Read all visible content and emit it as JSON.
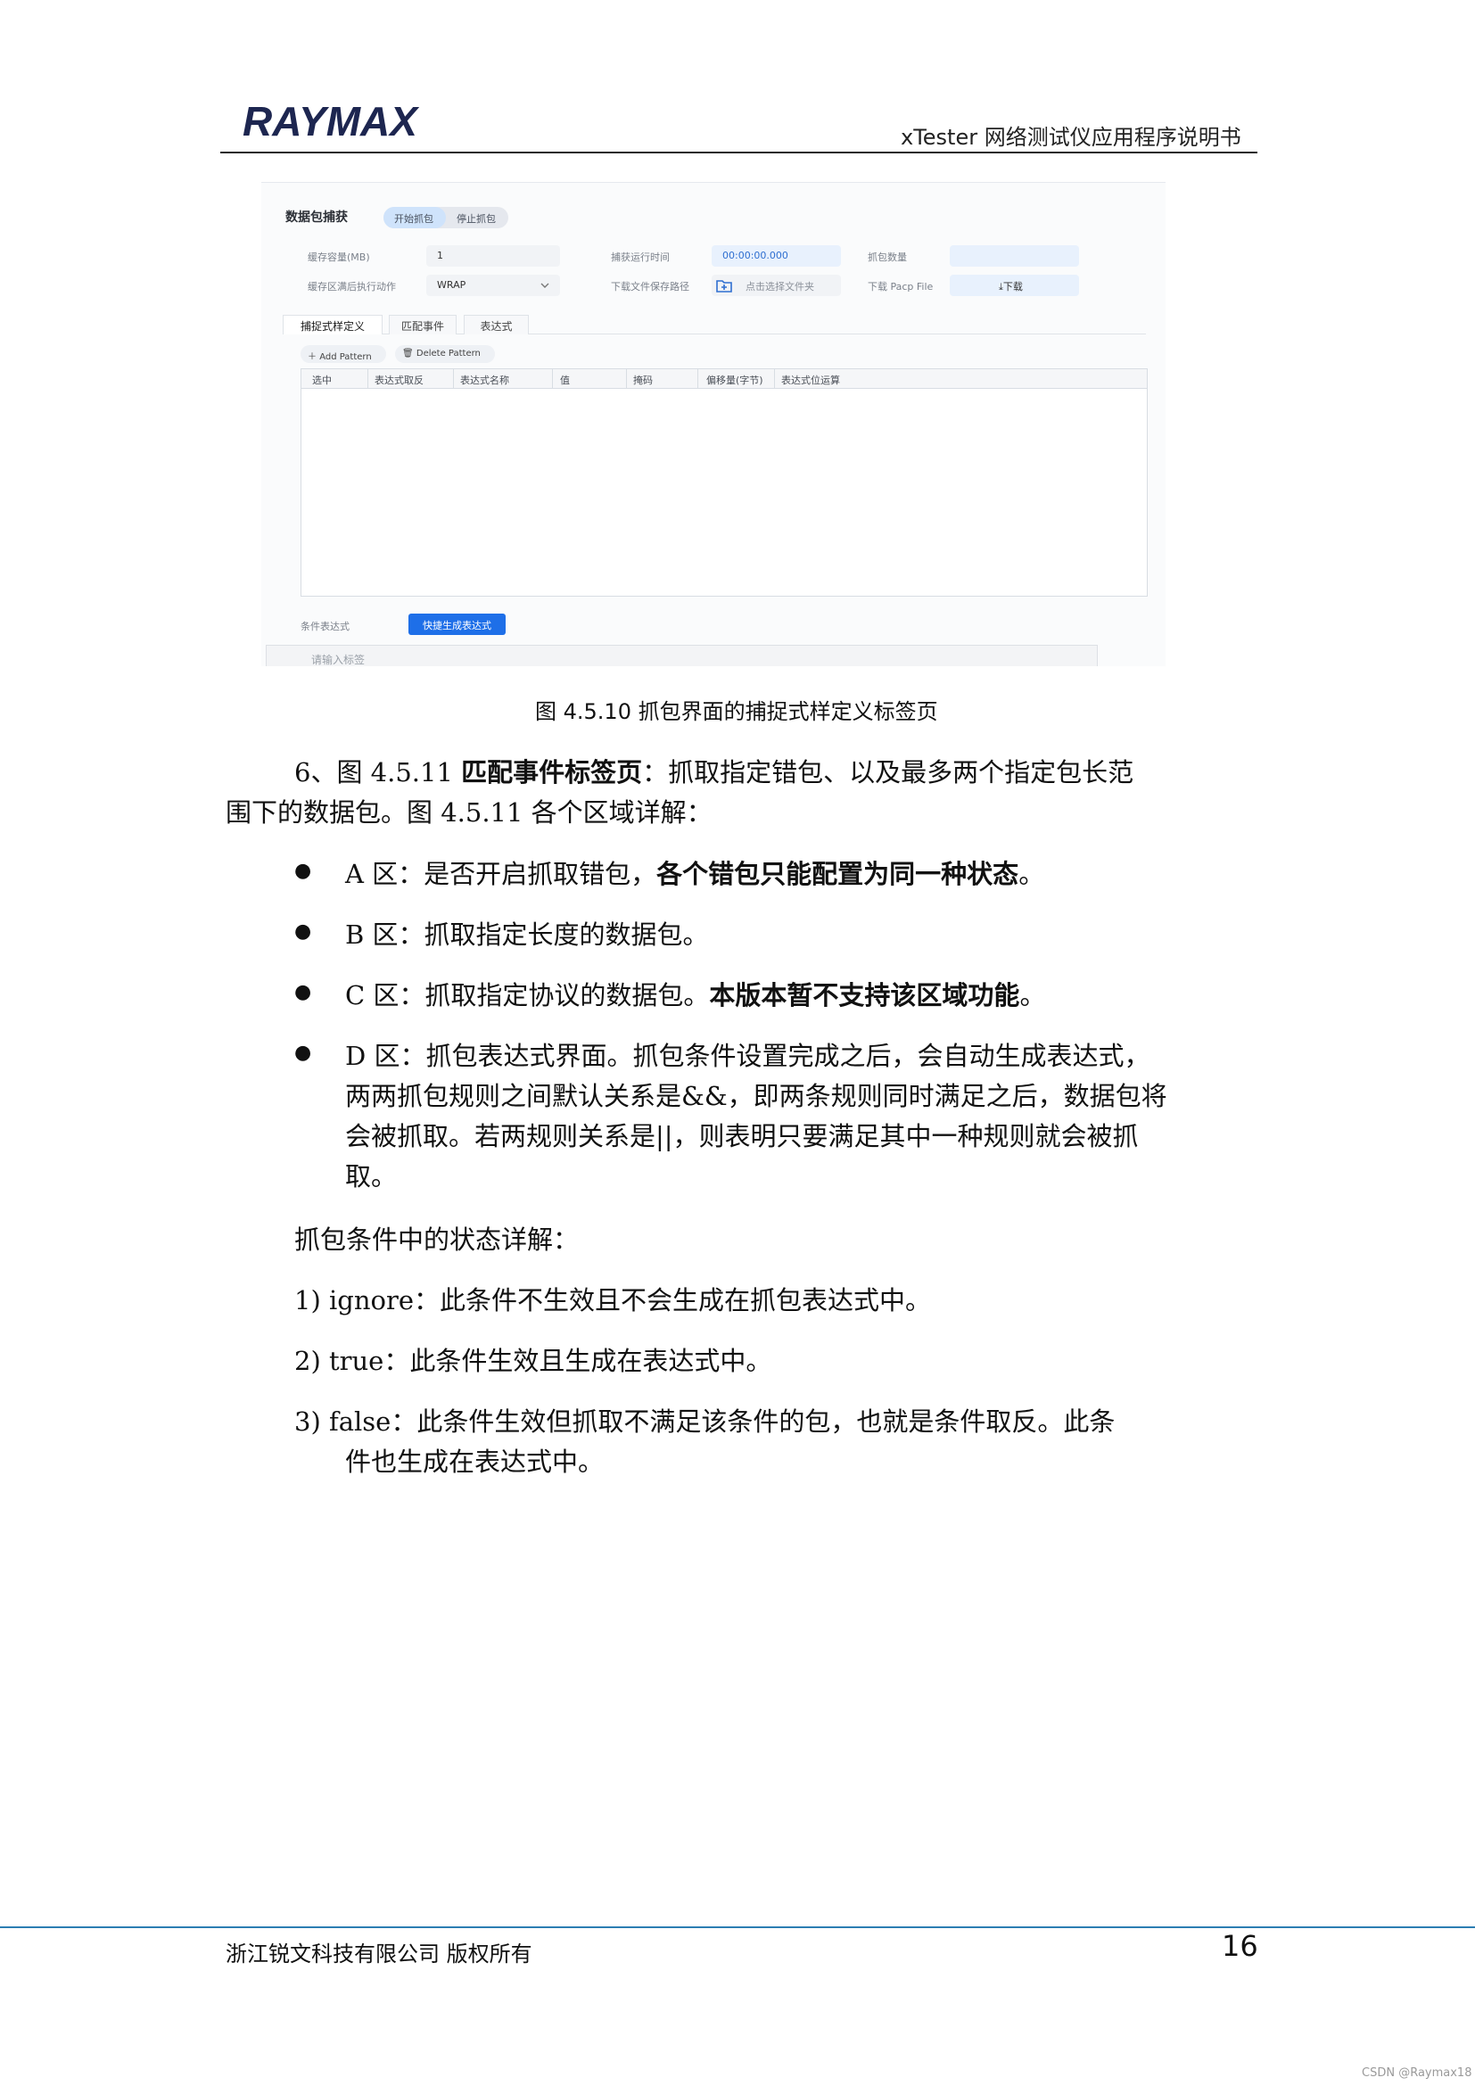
{
  "header": {
    "brand": "RAYMAX",
    "doc_title": "xTester 网络测试仪应用程序说明书"
  },
  "screenshot": {
    "title": "数据包捕获",
    "start_capture": "开始抓包",
    "stop_capture": "停止抓包",
    "buffer_label": "缓存容量(MB)",
    "buffer_value": "1",
    "full_action_label": "缓存区满后执行动作",
    "full_action_value": "WRAP",
    "run_time_label": "捕获运行时间",
    "run_time_value": "00:00:00.000",
    "save_path_label": "下载文件保存路径",
    "choose_folder": "点击选择文件夹",
    "packet_count_label": "抓包数量",
    "pcap_label": "下载 Pacp File",
    "download_label": "下载",
    "tabs": [
      "捕捉式样定义",
      "匹配事件",
      "表达式"
    ],
    "add_pattern": "Add Pattern",
    "delete_pattern": "Delete Pattern",
    "columns": [
      "选中",
      "表达式取反",
      "表达式名称",
      "值",
      "掩码",
      "偏移量(字节)",
      "表达式位运算"
    ],
    "cond_label": "条件表达式",
    "generate_button": "快捷生成表达式",
    "expr_placeholder": "请输入标签"
  },
  "caption": "图 4.5.10 抓包界面的捕捉式样定义标签页",
  "intro": {
    "line1_pre": "6、图 4.5.11 ",
    "line1_bold": "匹配事件标签页",
    "line1_post": "：抓取指定错包、以及最多两个指定包长范",
    "line2": "围下的数据包。图 4.5.11 各个区域详解："
  },
  "bullets": {
    "a_pre": "A 区：是否开启抓取错包，",
    "a_bold": "各个错包只能配置为同一种状态",
    "a_post": "。",
    "b": "B 区：抓取指定长度的数据包。",
    "c_pre": "C 区：抓取指定协议的数据包。",
    "c_bold": "本版本暂不支持该区域功能",
    "c_post": "。",
    "d1": "D 区：抓包表达式界面。抓包条件设置完成之后，会自动生成表达式，",
    "d2": "两两抓包规则之间默认关系是&&，即两条规则同时满足之后，数据包将",
    "d3": "会被抓取。若两规则关系是||，则表明只要满足其中一种规则就会被抓",
    "d4": "取。"
  },
  "states": {
    "heading": "抓包条件中的状态详解：",
    "s1": "1)  ignore：此条件不生效且不会生成在抓包表达式中。",
    "s2": "2)  true：此条件生效且生成在表达式中。",
    "s3a": "3)  false：此条件生效但抓取不满足该条件的包，也就是条件取反。此条",
    "s3b": "件也生成在表达式中。"
  },
  "footer": {
    "company": "浙江锐文科技有限公司 版权所有",
    "page": "16",
    "watermark": "CSDN @Raymax18"
  }
}
